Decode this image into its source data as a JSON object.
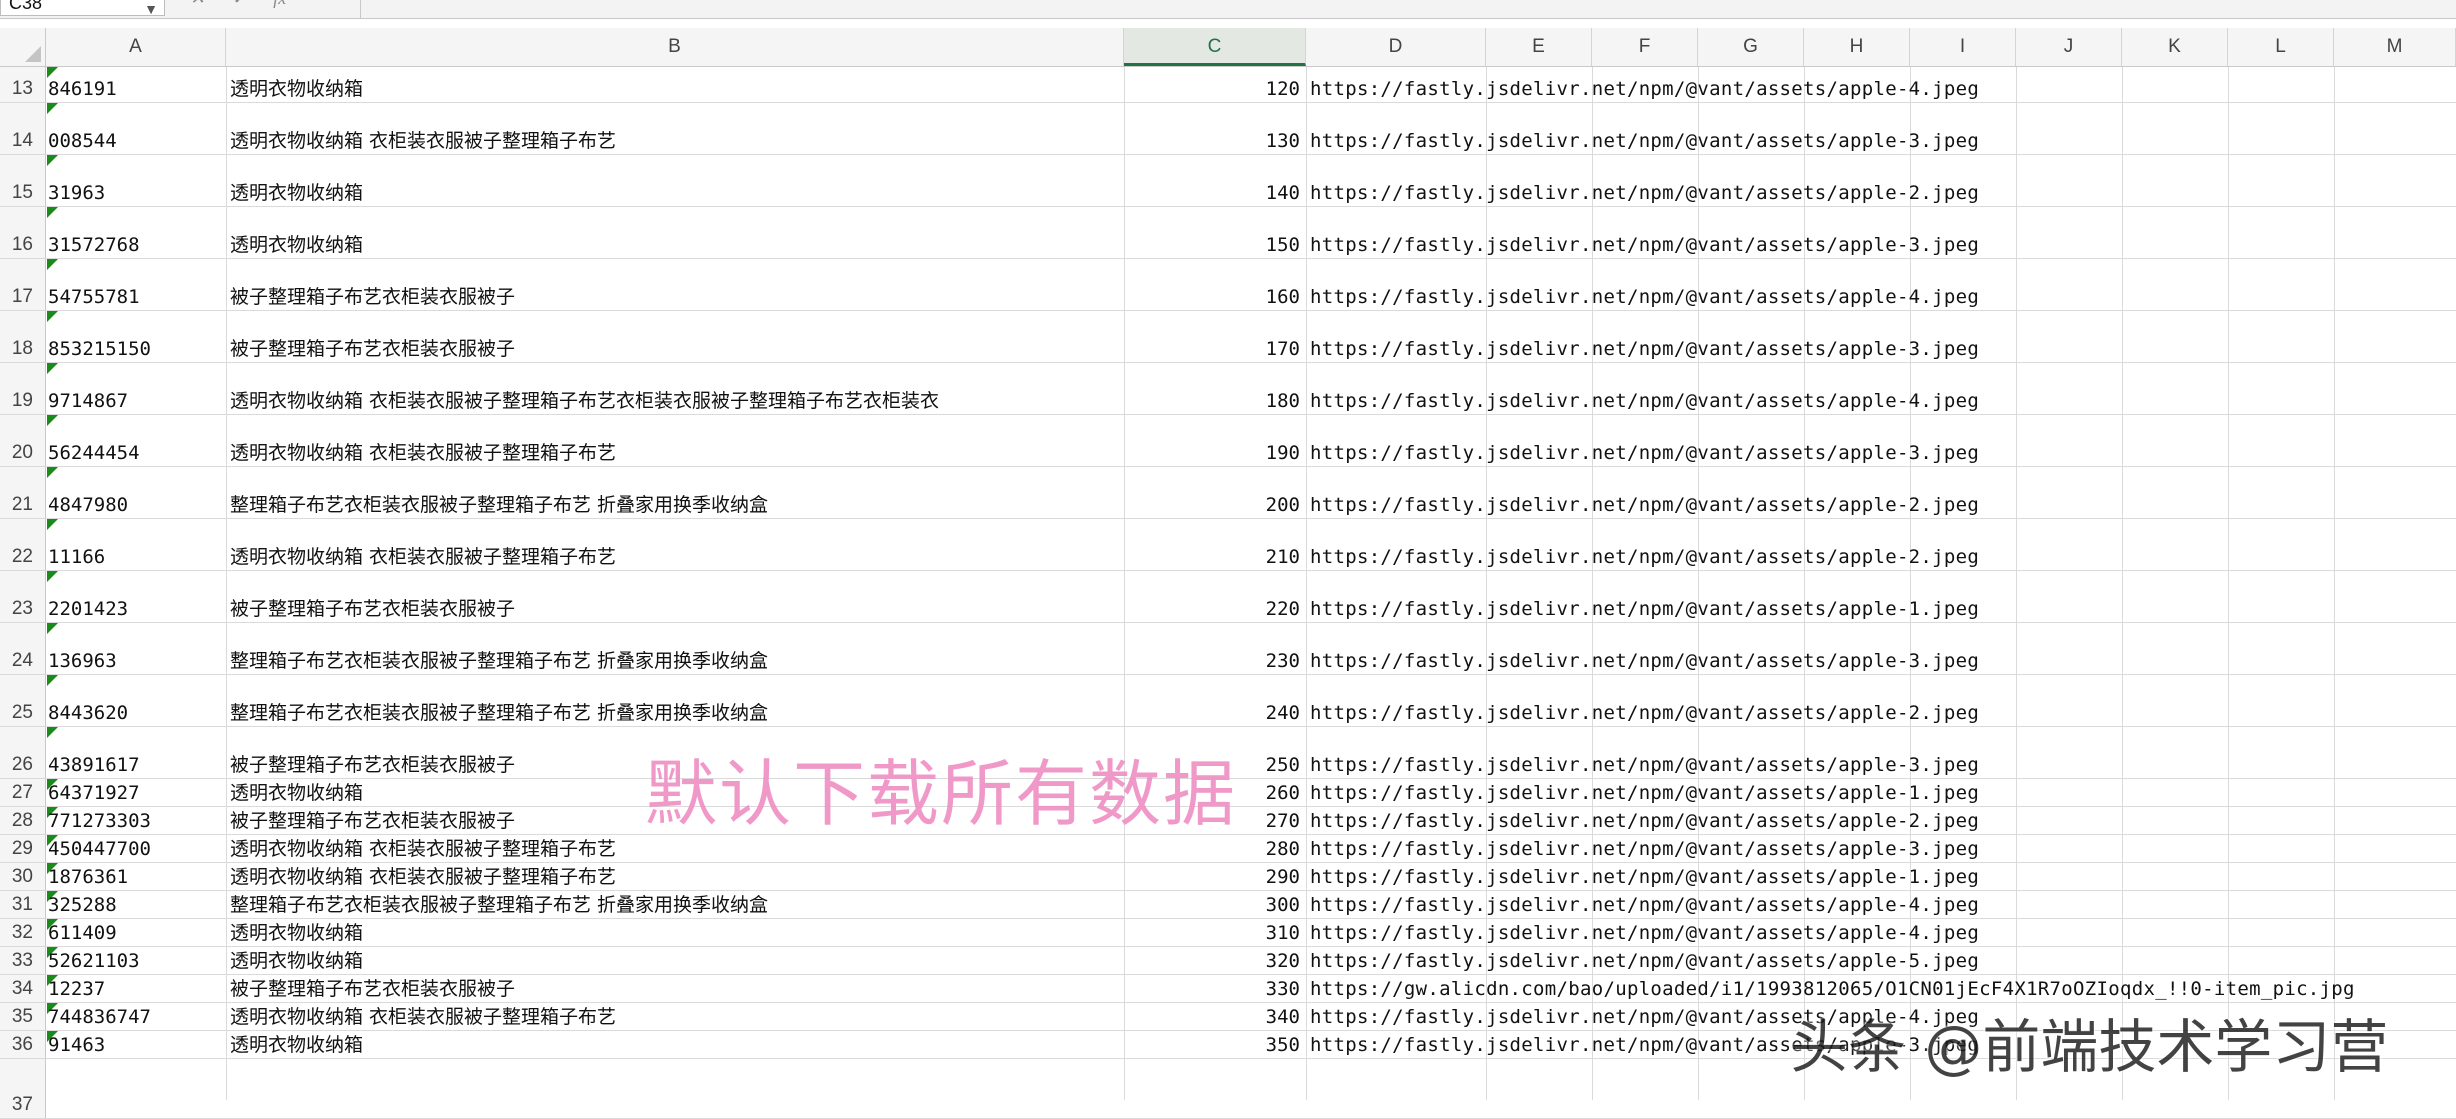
{
  "name_box": {
    "value": "C38"
  },
  "formula_bar": {
    "cancel": "✕",
    "confirm": "✓",
    "fx": "fx"
  },
  "columns": [
    "A",
    "B",
    "C",
    "D",
    "E",
    "F",
    "G",
    "H",
    "I",
    "J",
    "K",
    "L",
    "M"
  ],
  "selected_column": "C",
  "rows": [
    {
      "num": "13",
      "a": "846191",
      "b": "透明衣物收纳箱",
      "c": "120",
      "d": "https://fastly.jsdelivr.net/npm/@vant/assets/apple-4.jpeg"
    },
    {
      "num": "14",
      "a": "008544",
      "b": "透明衣物收纳箱 衣柜装衣服被子整理箱子布艺",
      "c": "130",
      "d": "https://fastly.jsdelivr.net/npm/@vant/assets/apple-3.jpeg"
    },
    {
      "num": "15",
      "a": "31963",
      "b": "透明衣物收纳箱",
      "c": "140",
      "d": "https://fastly.jsdelivr.net/npm/@vant/assets/apple-2.jpeg"
    },
    {
      "num": "16",
      "a": "31572768",
      "b": "透明衣物收纳箱",
      "c": "150",
      "d": "https://fastly.jsdelivr.net/npm/@vant/assets/apple-3.jpeg"
    },
    {
      "num": "17",
      "a": "54755781",
      "b": "被子整理箱子布艺衣柜装衣服被子",
      "c": "160",
      "d": "https://fastly.jsdelivr.net/npm/@vant/assets/apple-4.jpeg"
    },
    {
      "num": "18",
      "a": "853215150",
      "b": "被子整理箱子布艺衣柜装衣服被子",
      "c": "170",
      "d": "https://fastly.jsdelivr.net/npm/@vant/assets/apple-3.jpeg"
    },
    {
      "num": "19",
      "a": "9714867",
      "b": "透明衣物收纳箱 衣柜装衣服被子整理箱子布艺衣柜装衣服被子整理箱子布艺衣柜装衣",
      "c": "180",
      "d": "https://fastly.jsdelivr.net/npm/@vant/assets/apple-4.jpeg"
    },
    {
      "num": "20",
      "a": "56244454",
      "b": "透明衣物收纳箱 衣柜装衣服被子整理箱子布艺",
      "c": "190",
      "d": "https://fastly.jsdelivr.net/npm/@vant/assets/apple-3.jpeg"
    },
    {
      "num": "21",
      "a": "4847980",
      "b": "整理箱子布艺衣柜装衣服被子整理箱子布艺 折叠家用换季收纳盒",
      "c": "200",
      "d": "https://fastly.jsdelivr.net/npm/@vant/assets/apple-2.jpeg"
    },
    {
      "num": "22",
      "a": "11166",
      "b": "透明衣物收纳箱 衣柜装衣服被子整理箱子布艺",
      "c": "210",
      "d": "https://fastly.jsdelivr.net/npm/@vant/assets/apple-2.jpeg"
    },
    {
      "num": "23",
      "a": "2201423",
      "b": "被子整理箱子布艺衣柜装衣服被子",
      "c": "220",
      "d": "https://fastly.jsdelivr.net/npm/@vant/assets/apple-1.jpeg"
    },
    {
      "num": "24",
      "a": "136963",
      "b": "整理箱子布艺衣柜装衣服被子整理箱子布艺 折叠家用换季收纳盒",
      "c": "230",
      "d": "https://fastly.jsdelivr.net/npm/@vant/assets/apple-3.jpeg"
    },
    {
      "num": "25",
      "a": "8443620",
      "b": "整理箱子布艺衣柜装衣服被子整理箱子布艺 折叠家用换季收纳盒",
      "c": "240",
      "d": "https://fastly.jsdelivr.net/npm/@vant/assets/apple-2.jpeg"
    },
    {
      "num": "26",
      "a": "43891617",
      "b": "被子整理箱子布艺衣柜装衣服被子",
      "c": "250",
      "d": "https://fastly.jsdelivr.net/npm/@vant/assets/apple-3.jpeg"
    },
    {
      "num": "27",
      "a": "64371927",
      "b": "透明衣物收纳箱",
      "c": "260",
      "d": "https://fastly.jsdelivr.net/npm/@vant/assets/apple-1.jpeg"
    },
    {
      "num": "28",
      "a": "771273303",
      "b": "被子整理箱子布艺衣柜装衣服被子",
      "c": "270",
      "d": "https://fastly.jsdelivr.net/npm/@vant/assets/apple-2.jpeg"
    },
    {
      "num": "29",
      "a": "450447700",
      "b": "透明衣物收纳箱 衣柜装衣服被子整理箱子布艺",
      "c": "280",
      "d": "https://fastly.jsdelivr.net/npm/@vant/assets/apple-3.jpeg"
    },
    {
      "num": "30",
      "a": "1876361",
      "b": "透明衣物收纳箱 衣柜装衣服被子整理箱子布艺",
      "c": "290",
      "d": "https://fastly.jsdelivr.net/npm/@vant/assets/apple-1.jpeg"
    },
    {
      "num": "31",
      "a": "325288",
      "b": "整理箱子布艺衣柜装衣服被子整理箱子布艺 折叠家用换季收纳盒",
      "c": "300",
      "d": "https://fastly.jsdelivr.net/npm/@vant/assets/apple-4.jpeg"
    },
    {
      "num": "32",
      "a": "611409",
      "b": "透明衣物收纳箱",
      "c": "310",
      "d": "https://fastly.jsdelivr.net/npm/@vant/assets/apple-4.jpeg"
    },
    {
      "num": "33",
      "a": "52621103",
      "b": "透明衣物收纳箱",
      "c": "320",
      "d": "https://fastly.jsdelivr.net/npm/@vant/assets/apple-5.jpeg"
    },
    {
      "num": "34",
      "a": "12237",
      "b": "被子整理箱子布艺衣柜装衣服被子",
      "c": "330",
      "d": "https://gw.alicdn.com/bao/uploaded/i1/1993812065/O1CN01jEcF4X1R7oOZIoqdx_!!0-item_pic.jpg"
    },
    {
      "num": "35",
      "a": "744836747",
      "b": "透明衣物收纳箱 衣柜装衣服被子整理箱子布艺",
      "c": "340",
      "d": "https://fastly.jsdelivr.net/npm/@vant/assets/apple-4.jpeg"
    },
    {
      "num": "36",
      "a": "91463",
      "b": "透明衣物收纳箱",
      "c": "350",
      "d": "https://fastly.jsdelivr.net/npm/@vant/assets/apple-3.jpeg"
    },
    {
      "num": "37",
      "a": "",
      "b": "",
      "c": "",
      "d": ""
    }
  ],
  "watermark_center": "默认下载所有数据",
  "watermark_corner": "头条 @前端技术学习营",
  "colors": {
    "accent": "#217346",
    "marker": "#1a8a1a",
    "watermark": "#ef8fc4"
  }
}
